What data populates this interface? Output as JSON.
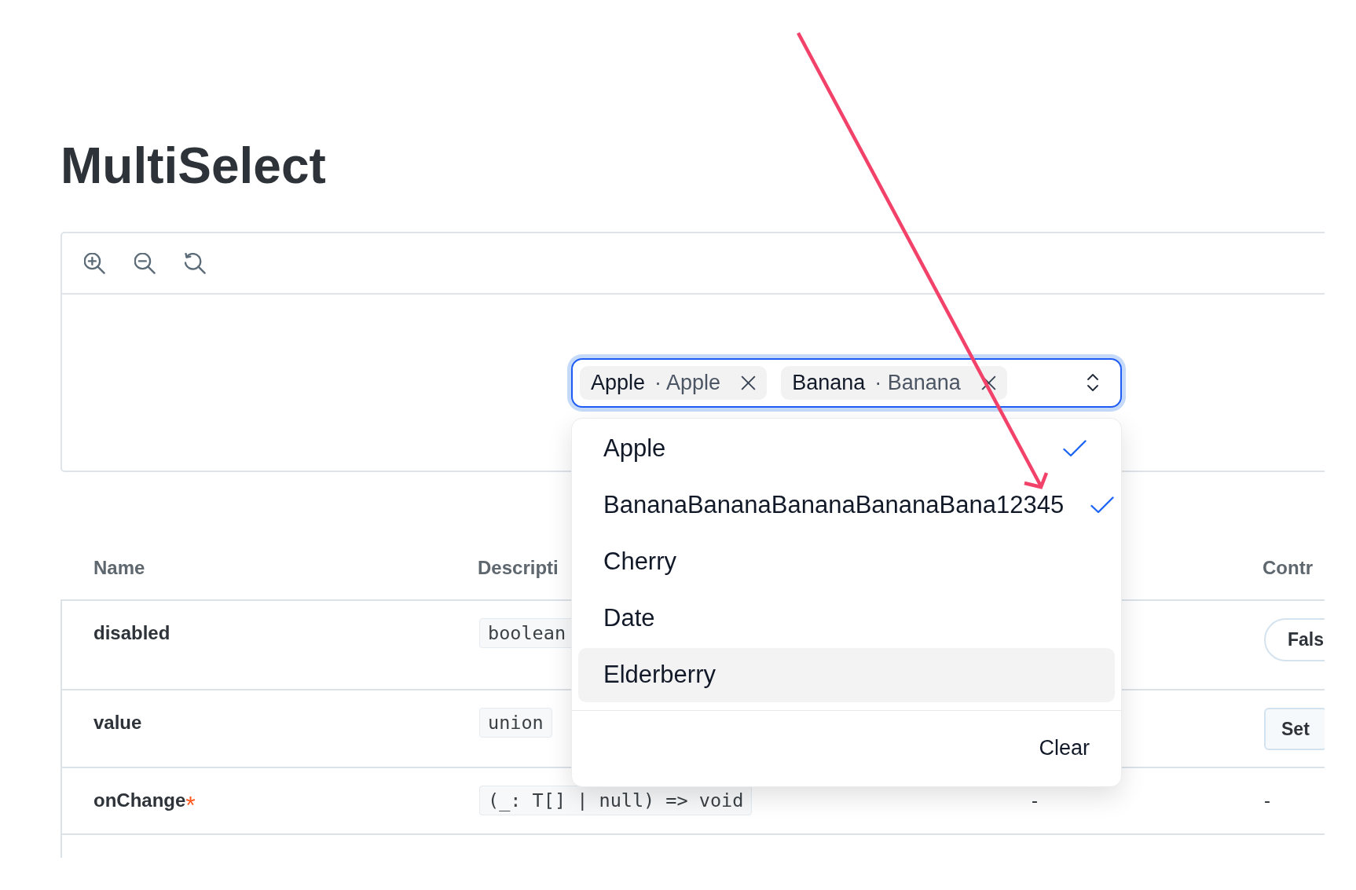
{
  "page": {
    "title": "MultiSelect"
  },
  "toolbar": {
    "tools": [
      {
        "kind": "zoom_in"
      },
      {
        "kind": "zoom_out"
      },
      {
        "kind": "reset"
      }
    ]
  },
  "multiselect": {
    "focused": true,
    "open": true,
    "tags": [
      {
        "label": "Apple",
        "detail": "· Apple"
      },
      {
        "label": "Banana",
        "detail": "· Banana"
      }
    ],
    "options": [
      {
        "label": "Apple",
        "selected": true,
        "highlighted": false
      },
      {
        "label": "BananaBananaBananaBananaBana12345",
        "selected": true,
        "highlighted": false
      },
      {
        "label": "Cherry",
        "selected": false,
        "highlighted": false
      },
      {
        "label": "Date",
        "selected": false,
        "highlighted": false
      },
      {
        "label": "Elderberry",
        "selected": false,
        "highlighted": true
      }
    ],
    "footer_button": "Clear"
  },
  "table": {
    "columns": [
      "Name",
      "Descripti",
      "Contr"
    ],
    "rows": [
      {
        "name": "disabled",
        "type": "boolean",
        "control": {
          "kind": "pill",
          "label": "Fals"
        }
      },
      {
        "name": "value",
        "type": "union",
        "control": {
          "kind": "button",
          "label": "Set"
        }
      },
      {
        "name": "onChange",
        "required_mark": "*",
        "type": "(_: T[] | null) => void",
        "default": "-",
        "control": {
          "kind": "text",
          "label": "-"
        }
      }
    ]
  },
  "annotations": [
    {
      "kind": "arrow"
    }
  ]
}
